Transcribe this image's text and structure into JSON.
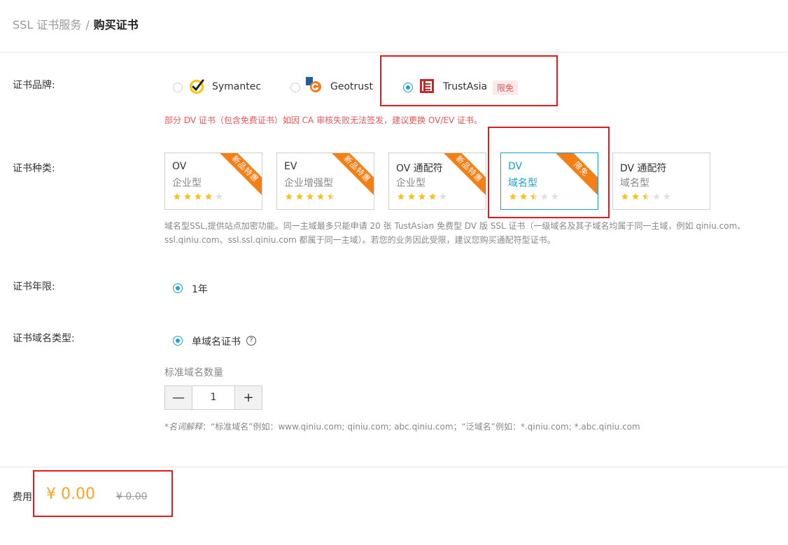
{
  "breadcrumb": {
    "parent": "SSL 证书服务",
    "separator": "/",
    "current": "购买证书"
  },
  "brand": {
    "label": "证书品牌:",
    "options": [
      {
        "name": "Symantec",
        "selected": false,
        "icon": "symantec-check-icon"
      },
      {
        "name": "Geotrust",
        "selected": false,
        "icon": "geotrust-logo-icon"
      },
      {
        "name": "TrustAsia",
        "selected": true,
        "icon": "trustasia-logo-icon",
        "badge": "限免"
      }
    ],
    "warning": "部分 DV 证书（包含免费证书）如因 CA 审核失败无法签发，建议更换 OV/EV 证书。"
  },
  "type": {
    "label": "证书种类:",
    "cards": [
      {
        "name": "OV",
        "sub": "企业型",
        "stars": 4,
        "ribbon": "新品特惠",
        "selected": false
      },
      {
        "name": "EV",
        "sub": "企业增强型",
        "stars": 4.5,
        "ribbon": "新品特惠",
        "selected": false
      },
      {
        "name": "OV 通配符",
        "sub": "企业型",
        "stars": 4,
        "ribbon": "新品特惠",
        "selected": false
      },
      {
        "name": "DV",
        "sub": "域名型",
        "stars": 2.5,
        "ribbon": "限免",
        "selected": true
      },
      {
        "name": "DV 通配符",
        "sub": "域名型",
        "stars": 2.5,
        "ribbon": "",
        "selected": false
      }
    ],
    "desc": "域名型SSL,提供站点加密功能。同一主域最多只能申请 20 张 TustAsian 免费型 DV 版 SSL 证书（一级域名及其子域名均属于同一主域，例如 qiniu.com、ssl.qiniu.com、ssl.ssl.qiniu.com 都属于同一主域）。若您的业务因此受限，建议您购买通配符型证书。"
  },
  "period": {
    "label": "证书年限:",
    "option": "1年"
  },
  "domainType": {
    "label": "证书域名类型:",
    "option": "单域名证书",
    "help": "?",
    "qtyTitle": "标准域名数量",
    "qty": "1",
    "minus": "—",
    "plus": "+",
    "noteEm": "*名词解释",
    "note": "：“标准域名”例如：www.qiniu.com; qiniu.com; abc.qiniu.com；“泛域名”例如：*.qiniu.com; *.abc.qiniu.com"
  },
  "fee": {
    "label": "费用:",
    "price": "¥ 0.00",
    "original": "¥ 0.00"
  },
  "colors": {
    "accent": "#1aa0d6",
    "star": "#f7c21c",
    "star_empty": "#e0e0e0",
    "ribbon": "#f57f17",
    "price": "#f5a623",
    "highlight": "#e21c1c"
  }
}
